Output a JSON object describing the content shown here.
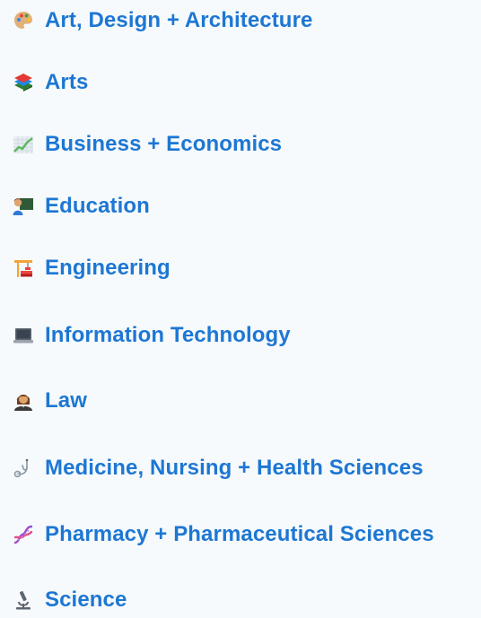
{
  "menu": {
    "items": [
      {
        "label": "Art, Design + Architecture",
        "icon": "artist-palette-icon"
      },
      {
        "label": "Arts",
        "icon": "books-icon"
      },
      {
        "label": "Business + Economics",
        "icon": "chart-increasing-icon"
      },
      {
        "label": "Education",
        "icon": "teacher-icon"
      },
      {
        "label": "Engineering",
        "icon": "building-construction-icon"
      },
      {
        "label": "Information Technology",
        "icon": "laptop-icon"
      },
      {
        "label": "Law",
        "icon": "judge-icon"
      },
      {
        "label": "Medicine, Nursing + Health Sciences",
        "icon": "stethoscope-icon"
      },
      {
        "label": "Pharmacy + Pharmaceutical Sciences",
        "icon": "dna-icon"
      },
      {
        "label": "Science",
        "icon": "microscope-icon"
      }
    ]
  },
  "colors": {
    "link": "#1d77d3",
    "background": "#f7fafc"
  }
}
